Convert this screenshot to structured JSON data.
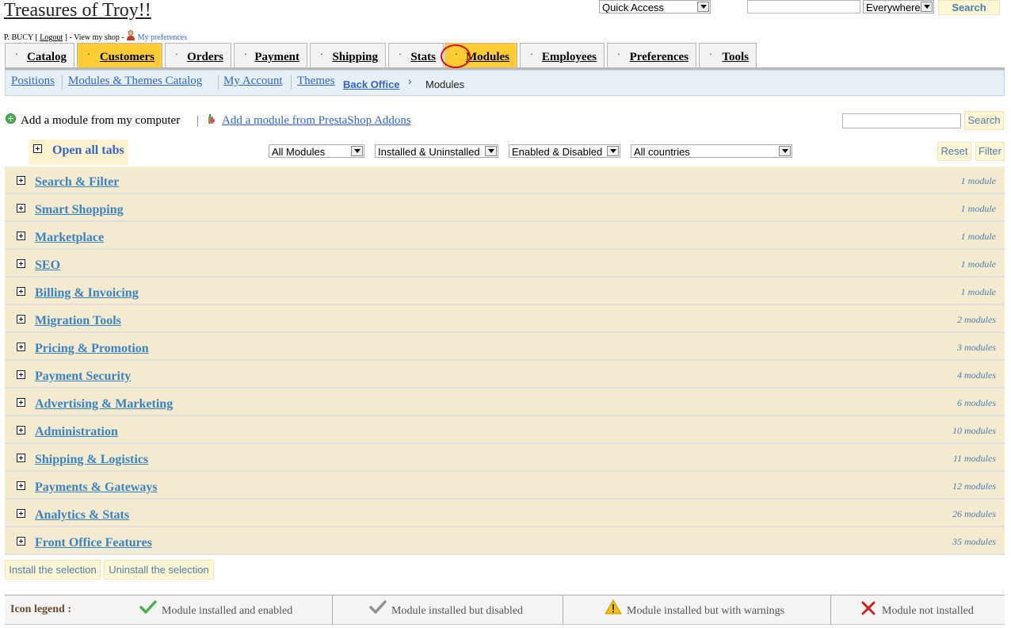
{
  "header": {
    "shop_title": "Treasures of Troy!!",
    "user_name": "P. BUCY",
    "logout_label": "Logout",
    "view_shop_label": "View my shop",
    "preferences_link": "My preferences",
    "quick_access": "Quick Access",
    "search_value": "",
    "search_scope": "Everywhere",
    "search_button": "Search"
  },
  "tabs": [
    {
      "label": "Catalog",
      "active": false
    },
    {
      "label": "Customers",
      "active": true
    },
    {
      "label": "Orders",
      "active": false
    },
    {
      "label": "Payment",
      "active": false
    },
    {
      "label": "Shipping",
      "active": false
    },
    {
      "label": "Stats",
      "active": false
    },
    {
      "label": "Modules",
      "active": true
    },
    {
      "label": "Employees",
      "active": false
    },
    {
      "label": "Preferences",
      "active": false
    },
    {
      "label": "Tools",
      "active": false
    }
  ],
  "subnav": {
    "items": [
      "Positions",
      "Modules & Themes Catalog",
      "My Account",
      "Themes"
    ],
    "breadcrumb_root": "Back Office",
    "breadcrumb_current": "Modules"
  },
  "add_module": {
    "from_computer": "Add a module from my computer",
    "from_addons": "Add a module from PrestaShop Addons",
    "search_value": "",
    "search_button": "Search"
  },
  "filters": {
    "open_all_tabs": "Open all tabs",
    "module_type": "All Modules",
    "install_status": "Installed & Uninstalled",
    "enabled_status": "Enabled & Disabled",
    "country": "All countries",
    "reset_button": "Reset",
    "filter_button": "Filter"
  },
  "categories": [
    {
      "name": "Search & Filter",
      "count": "1 module"
    },
    {
      "name": "Smart Shopping",
      "count": "1 module"
    },
    {
      "name": "Marketplace",
      "count": "1 module"
    },
    {
      "name": "SEO",
      "count": "1 module"
    },
    {
      "name": "Billing & Invoicing",
      "count": "1 module"
    },
    {
      "name": "Migration Tools",
      "count": "2 modules"
    },
    {
      "name": "Pricing & Promotion",
      "count": "3 modules"
    },
    {
      "name": "Payment Security",
      "count": "4 modules"
    },
    {
      "name": "Advertising & Marketing",
      "count": "6 modules"
    },
    {
      "name": "Administration",
      "count": "10 modules"
    },
    {
      "name": "Shipping & Logistics",
      "count": "11 modules"
    },
    {
      "name": "Payments & Gateways",
      "count": "12 modules"
    },
    {
      "name": "Analytics & Stats",
      "count": "26 modules"
    },
    {
      "name": "Front Office Features",
      "count": "35 modules"
    }
  ],
  "actions": {
    "install_selection": "Install the selection",
    "uninstall_selection": "Uninstall the selection"
  },
  "legend": {
    "title": "Icon legend :",
    "installed_enabled": "Module installed and enabled",
    "installed_disabled": "Module installed but disabled",
    "installed_warnings": "Module installed but with warnings",
    "not_installed": "Module not installed"
  },
  "colors": {
    "active_tab": "#ffcc33",
    "category_row": "#f4ead0",
    "link": "#3366cc",
    "annotation_circle": "#e01010",
    "check_green": "#4caf50",
    "cross_red": "#cc2222",
    "warning_yellow": "#f5c000"
  }
}
